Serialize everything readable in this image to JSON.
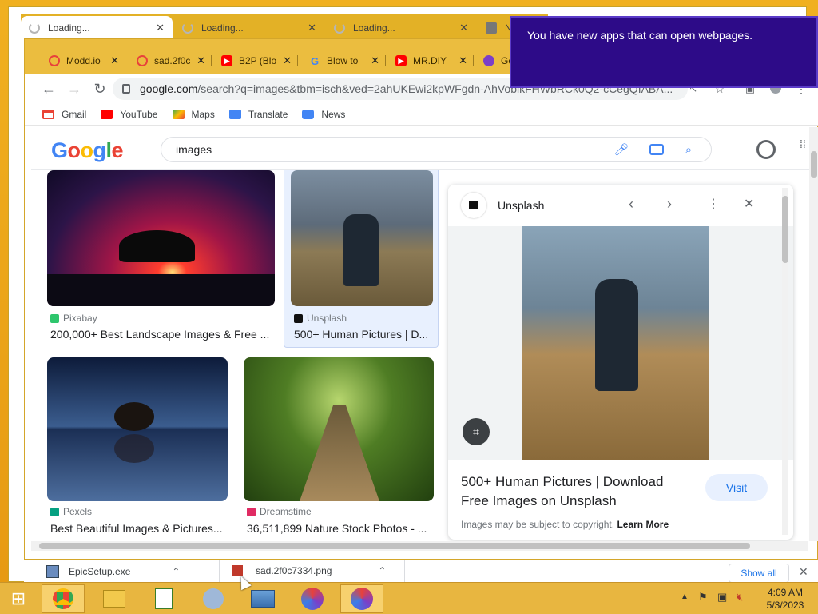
{
  "back_tabs": [
    {
      "title": "Loading..."
    },
    {
      "title": "Loading..."
    },
    {
      "title": "Loading..."
    },
    {
      "title": "N"
    }
  ],
  "tabs": [
    {
      "title": "Modd.io",
      "color": "#e8413b"
    },
    {
      "title": "sad.2f0c",
      "color": "#e8413b"
    },
    {
      "title": "B2P (Blo",
      "color": "#ff0000"
    },
    {
      "title": "Blow to",
      "color": "#4285f4"
    },
    {
      "title": "MR.DIY",
      "color": "#ff0000"
    },
    {
      "title": "Ge",
      "color": "#7b3fc7"
    }
  ],
  "omnibox": {
    "domain": "google.com",
    "path": "/search?q=images&tbm=isch&ved=2ahUKEwi2kpWFgdn-AhVoblkFHWbRCk0Q2-cCegQIABA..."
  },
  "bookmarks": [
    {
      "label": "Gmail",
      "color": "#ea4335"
    },
    {
      "label": "YouTube",
      "color": "#ff0000"
    },
    {
      "label": "Maps",
      "color": "#34a853"
    },
    {
      "label": "Translate",
      "color": "#4285f4"
    },
    {
      "label": "News",
      "color": "#4285f4"
    }
  ],
  "google": {
    "query": "images"
  },
  "results": [
    {
      "source": "Pixabay",
      "title": "200,000+ Best Landscape Images & Free ...",
      "source_color": "#2ec66d"
    },
    {
      "source": "Unsplash",
      "title": "500+ Human Pictures | D...",
      "source_color": "#111111"
    },
    {
      "source": "Pexels",
      "title": "Best Beautiful Images & Pictures...",
      "source_color": "#05a081"
    },
    {
      "source": "Dreamstime",
      "title": "36,511,899 Nature Stock Photos - ...",
      "source_color": "#e02b63"
    }
  ],
  "panel": {
    "source": "Unsplash",
    "title_line1": "500+ Human Pictures | Download",
    "title_line2": "Free Images on Unsplash",
    "visit": "Visit",
    "copyright": "Images may be subject to copyright.",
    "learn_more": "Learn More"
  },
  "downloads": [
    {
      "name": "EpicSetup.exe"
    },
    {
      "name": "sad.2f0c7334.png"
    }
  ],
  "downloads_show_all": "Show all",
  "notification": "You have new apps that can open webpages.",
  "clock": {
    "time": "4:09 AM",
    "date": "5/3/2023"
  }
}
